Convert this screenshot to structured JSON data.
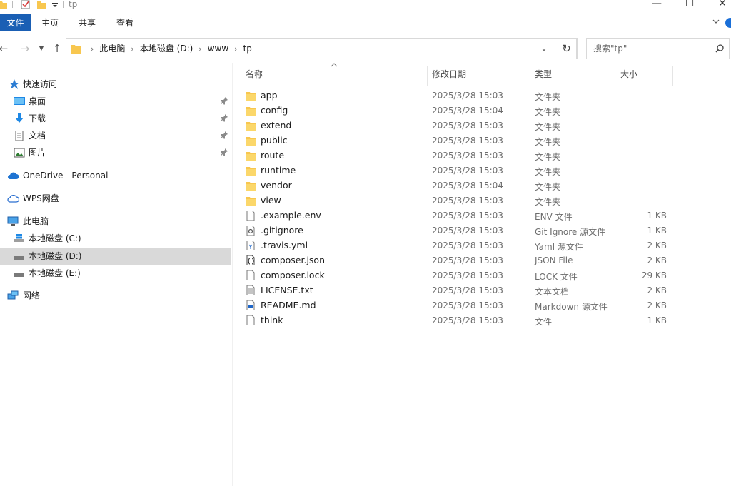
{
  "window": {
    "title": "tp",
    "controls": [
      "minimize-icon",
      "maximize-icon",
      "close-icon"
    ]
  },
  "ribbon": {
    "tabs": [
      "文件",
      "主页",
      "共享",
      "查看"
    ]
  },
  "address": {
    "crumbs": [
      "此电脑",
      "本地磁盘 (D:)",
      "www",
      "tp"
    ],
    "search_placeholder": "搜索\"tp\""
  },
  "nav": {
    "quick_access": "快速访问",
    "pinned": [
      {
        "label": "桌面",
        "icon": "desktop-icon"
      },
      {
        "label": "下载",
        "icon": "download-icon"
      },
      {
        "label": "文档",
        "icon": "document-icon"
      },
      {
        "label": "图片",
        "icon": "picture-icon"
      }
    ],
    "onedrive": "OneDrive - Personal",
    "wps": "WPS网盘",
    "this_pc": "此电脑",
    "drives": [
      "本地磁盘 (C:)",
      "本地磁盘 (D:)",
      "本地磁盘 (E:)"
    ],
    "selected_drive": "本地磁盘 (D:)",
    "network": "网络"
  },
  "columns": {
    "name": "名称",
    "date": "修改日期",
    "type": "类型",
    "size": "大小",
    "sorted_by": "name"
  },
  "files": [
    {
      "name": "app",
      "date": "2025/3/28 15:03",
      "type": "文件夹",
      "size": "",
      "icon": "folder-icon"
    },
    {
      "name": "config",
      "date": "2025/3/28 15:04",
      "type": "文件夹",
      "size": "",
      "icon": "folder-icon"
    },
    {
      "name": "extend",
      "date": "2025/3/28 15:03",
      "type": "文件夹",
      "size": "",
      "icon": "folder-icon"
    },
    {
      "name": "public",
      "date": "2025/3/28 15:03",
      "type": "文件夹",
      "size": "",
      "icon": "folder-icon"
    },
    {
      "name": "route",
      "date": "2025/3/28 15:03",
      "type": "文件夹",
      "size": "",
      "icon": "folder-icon"
    },
    {
      "name": "runtime",
      "date": "2025/3/28 15:03",
      "type": "文件夹",
      "size": "",
      "icon": "folder-icon"
    },
    {
      "name": "vendor",
      "date": "2025/3/28 15:04",
      "type": "文件夹",
      "size": "",
      "icon": "folder-icon"
    },
    {
      "name": "view",
      "date": "2025/3/28 15:03",
      "type": "文件夹",
      "size": "",
      "icon": "folder-icon"
    },
    {
      "name": ".example.env",
      "date": "2025/3/28 15:03",
      "type": "ENV 文件",
      "size": "1 KB",
      "icon": "file-icon"
    },
    {
      "name": ".gitignore",
      "date": "2025/3/28 15:03",
      "type": "Git Ignore 源文件",
      "size": "1 KB",
      "icon": "config-file-icon"
    },
    {
      "name": ".travis.yml",
      "date": "2025/3/28 15:03",
      "type": "Yaml 源文件",
      "size": "2 KB",
      "icon": "yaml-file-icon"
    },
    {
      "name": "composer.json",
      "date": "2025/3/28 15:03",
      "type": "JSON File",
      "size": "2 KB",
      "icon": "json-file-icon"
    },
    {
      "name": "composer.lock",
      "date": "2025/3/28 15:03",
      "type": "LOCK 文件",
      "size": "29 KB",
      "icon": "file-icon"
    },
    {
      "name": "LICENSE.txt",
      "date": "2025/3/28 15:03",
      "type": "文本文档",
      "size": "2 KB",
      "icon": "text-file-icon"
    },
    {
      "name": "README.md",
      "date": "2025/3/28 15:03",
      "type": "Markdown 源文件",
      "size": "2 KB",
      "icon": "markdown-file-icon"
    },
    {
      "name": "think",
      "date": "2025/3/28 15:03",
      "type": "文件",
      "size": "1 KB",
      "icon": "file-icon"
    }
  ],
  "colors": {
    "file_tab": "#1a5fb4",
    "folder": "#f8c74f",
    "selected": "#d9d9d9"
  }
}
